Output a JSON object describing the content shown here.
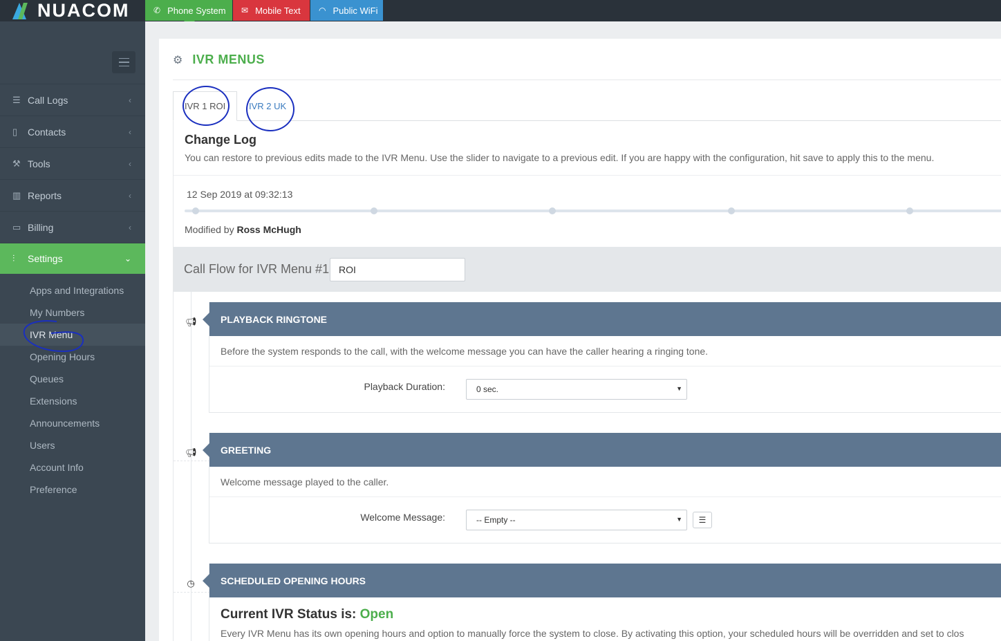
{
  "brand": {
    "name": "NUACOM"
  },
  "topbar": {
    "tabs": [
      {
        "label": "Phone System",
        "color": "#4cae4c"
      },
      {
        "label": "Mobile Text",
        "color": "#d9363e"
      },
      {
        "label": "Public WiFi",
        "color": "#3a92d0"
      }
    ]
  },
  "sidebar": {
    "items": [
      {
        "label": "Call Logs",
        "icon": "list-icon"
      },
      {
        "label": "Contacts",
        "icon": "address-book-icon"
      },
      {
        "label": "Tools",
        "icon": "wrench-icon"
      },
      {
        "label": "Reports",
        "icon": "bar-chart-icon"
      },
      {
        "label": "Billing",
        "icon": "folder-icon"
      },
      {
        "label": "Settings",
        "icon": "sliders-icon",
        "active": true
      }
    ],
    "settings_sub": [
      "Apps and Integrations",
      "My Numbers",
      "IVR Menu",
      "Opening Hours",
      "Queues",
      "Extensions",
      "Announcements",
      "Users",
      "Account Info",
      "Preference"
    ]
  },
  "page": {
    "title": "IVR MENUS"
  },
  "tabs": [
    "IVR 1 ROI",
    "IVR 2 UK"
  ],
  "change_log": {
    "title": "Change Log",
    "description": "You can restore to previous edits made to the IVR Menu. Use the slider to navigate to a previous edit. If you are happy with the configuration, hit save to apply this to the menu.",
    "date": "12 Sep 2019 at 09:32:13",
    "modified_prefix": "Modified by",
    "modified_by": "Ross McHugh"
  },
  "call_flow": {
    "label": "Call Flow for IVR Menu #1",
    "value": "ROI"
  },
  "playback": {
    "title": "PLAYBACK RINGTONE",
    "description": "Before the system responds to the call, with the welcome message you can have the caller hearing a ringing tone.",
    "field_label": "Playback Duration:",
    "field_value": "0 sec."
  },
  "greeting": {
    "title": "GREETING",
    "description": "Welcome message played to the caller.",
    "field_label": "Welcome Message:",
    "field_value": "-- Empty --"
  },
  "schedule": {
    "title": "SCHEDULED OPENING HOURS",
    "status_prefix": "Current IVR Status is:",
    "status_value": "Open",
    "description": "Every IVR Menu has its own opening hours and option to manually force the system to close. By activating this option, your scheduled hours will be overridden and set to clos"
  },
  "colors": {
    "accent": "#4cae4c",
    "section_header": "#5e7690",
    "sidebar": "#3b4752"
  }
}
